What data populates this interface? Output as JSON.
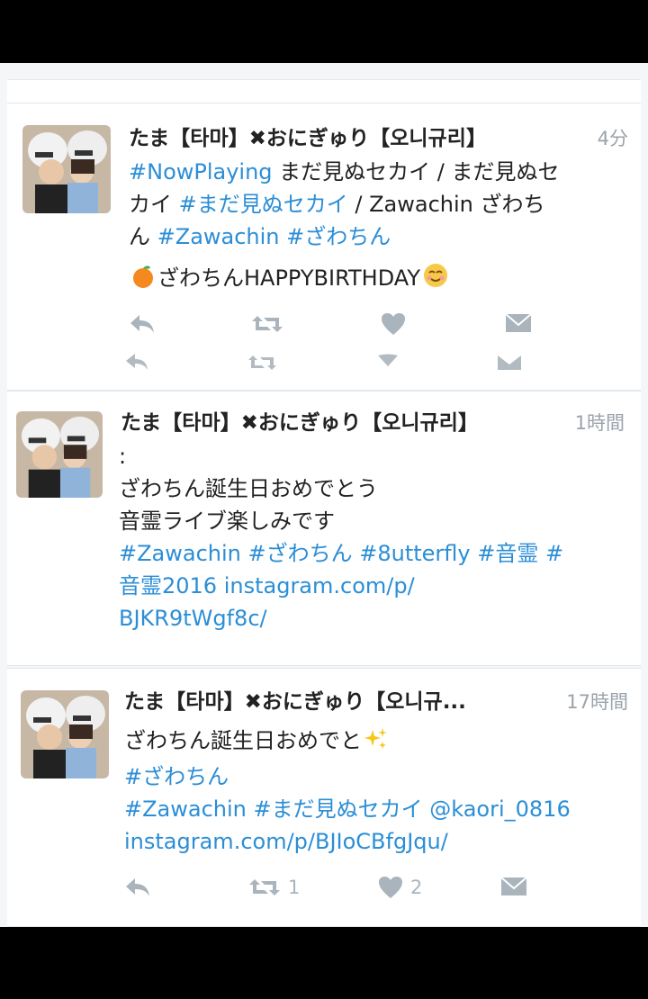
{
  "tweets": [
    {
      "name": "たま【타마】✖︎おにぎゅり【오니규리】",
      "time": "4分",
      "lines": [
        [
          {
            "t": "#NowPlaying",
            "tag": true
          },
          {
            "t": " まだ見ぬセカイ / まだ見ぬセ",
            "tag": false
          }
        ],
        [
          {
            "t": "カイ ",
            "tag": false
          },
          {
            "t": "#まだ見ぬセカイ",
            "tag": true
          },
          {
            "t": " / Zawachin ざわち",
            "tag": false
          }
        ],
        [
          {
            "t": "ん ",
            "tag": false
          },
          {
            "t": "#Zawachin",
            "tag": true
          },
          {
            "t": " ",
            "tag": false
          },
          {
            "t": "#ざわちん",
            "tag": true
          }
        ]
      ],
      "birthday_line": "ざわちんHAPPYBIRTHDAY",
      "retweets": "",
      "likes": ""
    },
    {
      "name": "たま【타마】✖︎おにぎゅり【오니규리】",
      "time": "1時間",
      "lines": [
        [
          {
            "t": ":",
            "tag": false
          }
        ],
        [
          {
            "t": "ざわちん誕生日おめでとう",
            "tag": false
          }
        ],
        [
          {
            "t": "音霊ライブ楽しみです",
            "tag": false
          }
        ],
        [
          {
            "t": "#Zawachin #ざわちん #8utterfly #音霊 #",
            "tag": true
          }
        ],
        [
          {
            "t": "音霊2016 instagram.com/p/",
            "tag": true
          }
        ],
        [
          {
            "t": "BJKR9tWgf8c/",
            "tag": true
          }
        ]
      ]
    },
    {
      "name": "たま【타마】✖︎おにぎゅり【오니규...",
      "time": "17時間",
      "lines": [
        [
          {
            "t": "ざわちん誕生日おめでと",
            "tag": false
          }
        ],
        [
          {
            "t": "#ざわちん",
            "tag": true
          }
        ],
        [
          {
            "t": "#Zawachin #まだ見ぬセカイ @kaori_0816",
            "tag": true
          }
        ],
        [
          {
            "t": "instagram.com/p/BJIoCBfgJqu/",
            "tag": true
          }
        ]
      ],
      "retweets": "1",
      "likes": "2"
    }
  ],
  "icons": [
    "reply-icon",
    "retweet-icon",
    "like-icon",
    "message-icon",
    "orange-emoji-icon",
    "smile-emoji-icon",
    "sparkles-emoji-icon"
  ],
  "colors": {
    "link": "#2b8ed6",
    "muted": "#aab4bc",
    "name": "#222222"
  }
}
